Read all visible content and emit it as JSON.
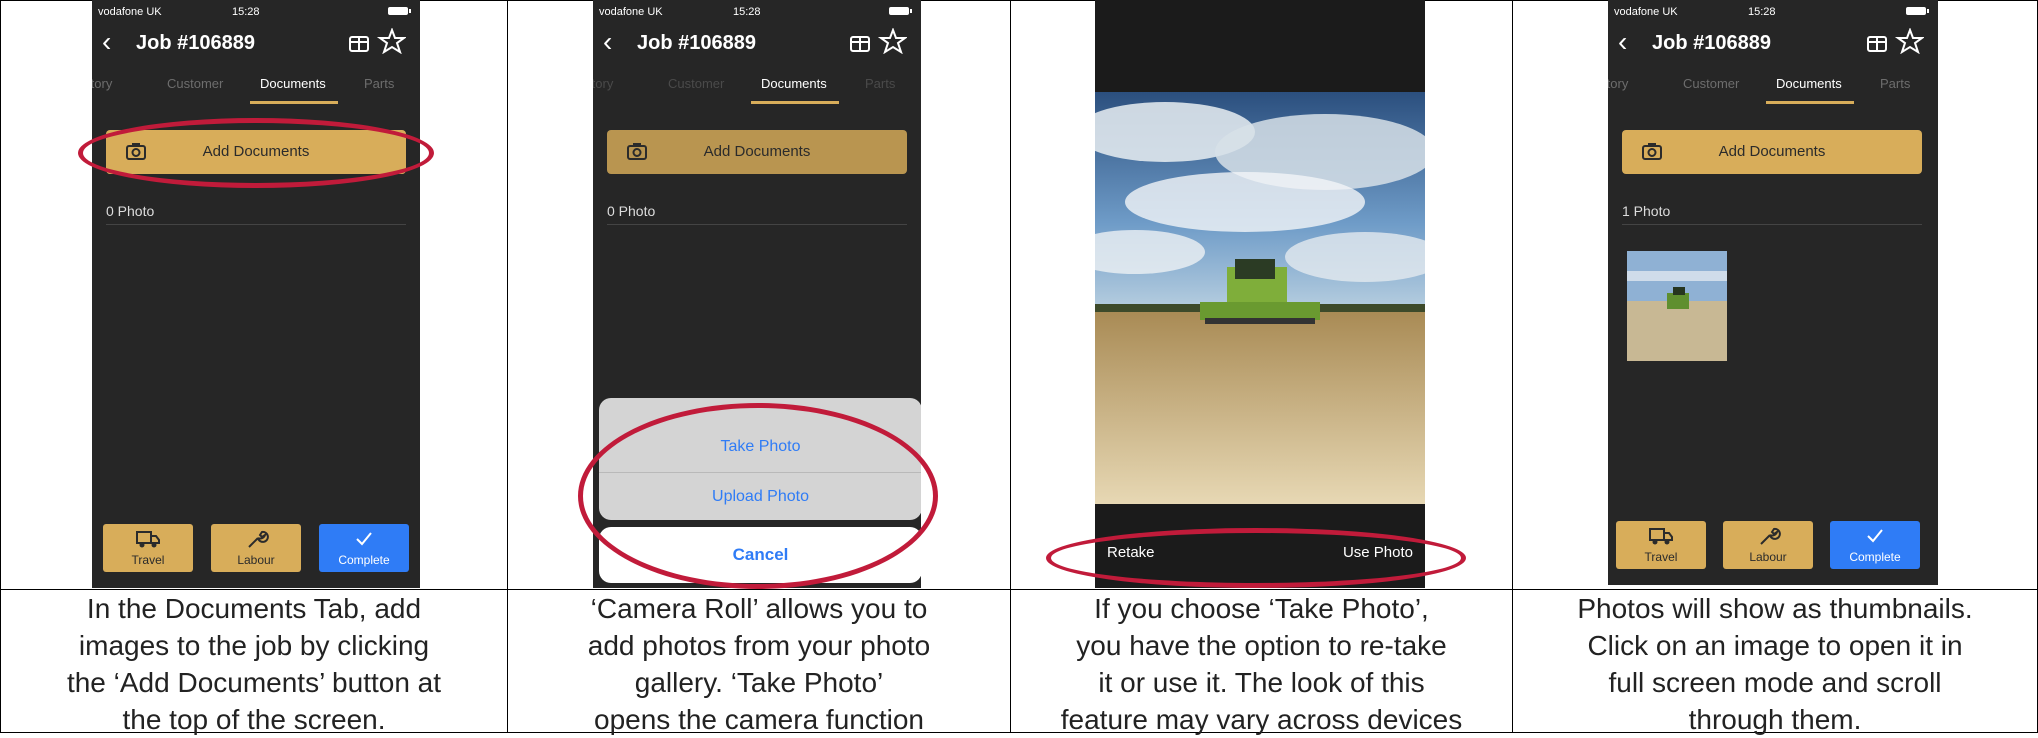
{
  "screens": [
    {
      "status": {
        "carrier": "vodafone UK",
        "time": "15:28"
      },
      "header": {
        "title": "Job #106889"
      },
      "tabs": [
        "Story",
        "Customer",
        "Documents",
        "Parts"
      ],
      "active_tab": "Documents",
      "add_button": "Add Documents",
      "photo_count": "0 Photo",
      "footer": [
        "Travel",
        "Labour",
        "Complete"
      ],
      "caption": [
        "In the Documents Tab, add",
        "images to the job by clicking",
        "the ‘Add Documents’ button at",
        "the top of the screen."
      ]
    },
    {
      "status": {
        "carrier": "vodafone UK",
        "time": "15:28"
      },
      "header": {
        "title": "Job #106889"
      },
      "tabs": [
        "Story",
        "Customer",
        "Documents",
        "Parts"
      ],
      "active_tab": "Documents",
      "add_button": "Add Documents",
      "photo_count": "0 Photo",
      "sheet": {
        "take_photo": "Take Photo",
        "upload_photo": "Upload Photo",
        "cancel": "Cancel"
      },
      "caption": [
        "‘Camera Roll’ allows you to",
        "add photos from your photo",
        "gallery. ‘Take Photo’",
        "opens the camera function"
      ]
    },
    {
      "camera": {
        "retake": "Retake",
        "use_photo": "Use Photo"
      },
      "caption": [
        "If you choose ‘Take Photo’,",
        "you have the option to re-take",
        "it or use it. The look of this",
        "feature may vary across devices"
      ]
    },
    {
      "status": {
        "carrier": "vodafone UK",
        "time": "15:28"
      },
      "header": {
        "title": "Job #106889"
      },
      "tabs": [
        "Story",
        "Customer",
        "Documents",
        "Parts"
      ],
      "active_tab": "Documents",
      "add_button": "Add Documents",
      "photo_count": "1 Photo",
      "footer": [
        "Travel",
        "Labour",
        "Complete"
      ],
      "caption": [
        "Photos will show as thumbnails.",
        "Click on an image to open it in",
        "full screen mode and scroll",
        "through them."
      ]
    }
  ],
  "colors": {
    "gold": "#d8ad5a",
    "blue": "#2f7cf6",
    "dark": "#262626",
    "annotation_red": "#c11b3a"
  }
}
